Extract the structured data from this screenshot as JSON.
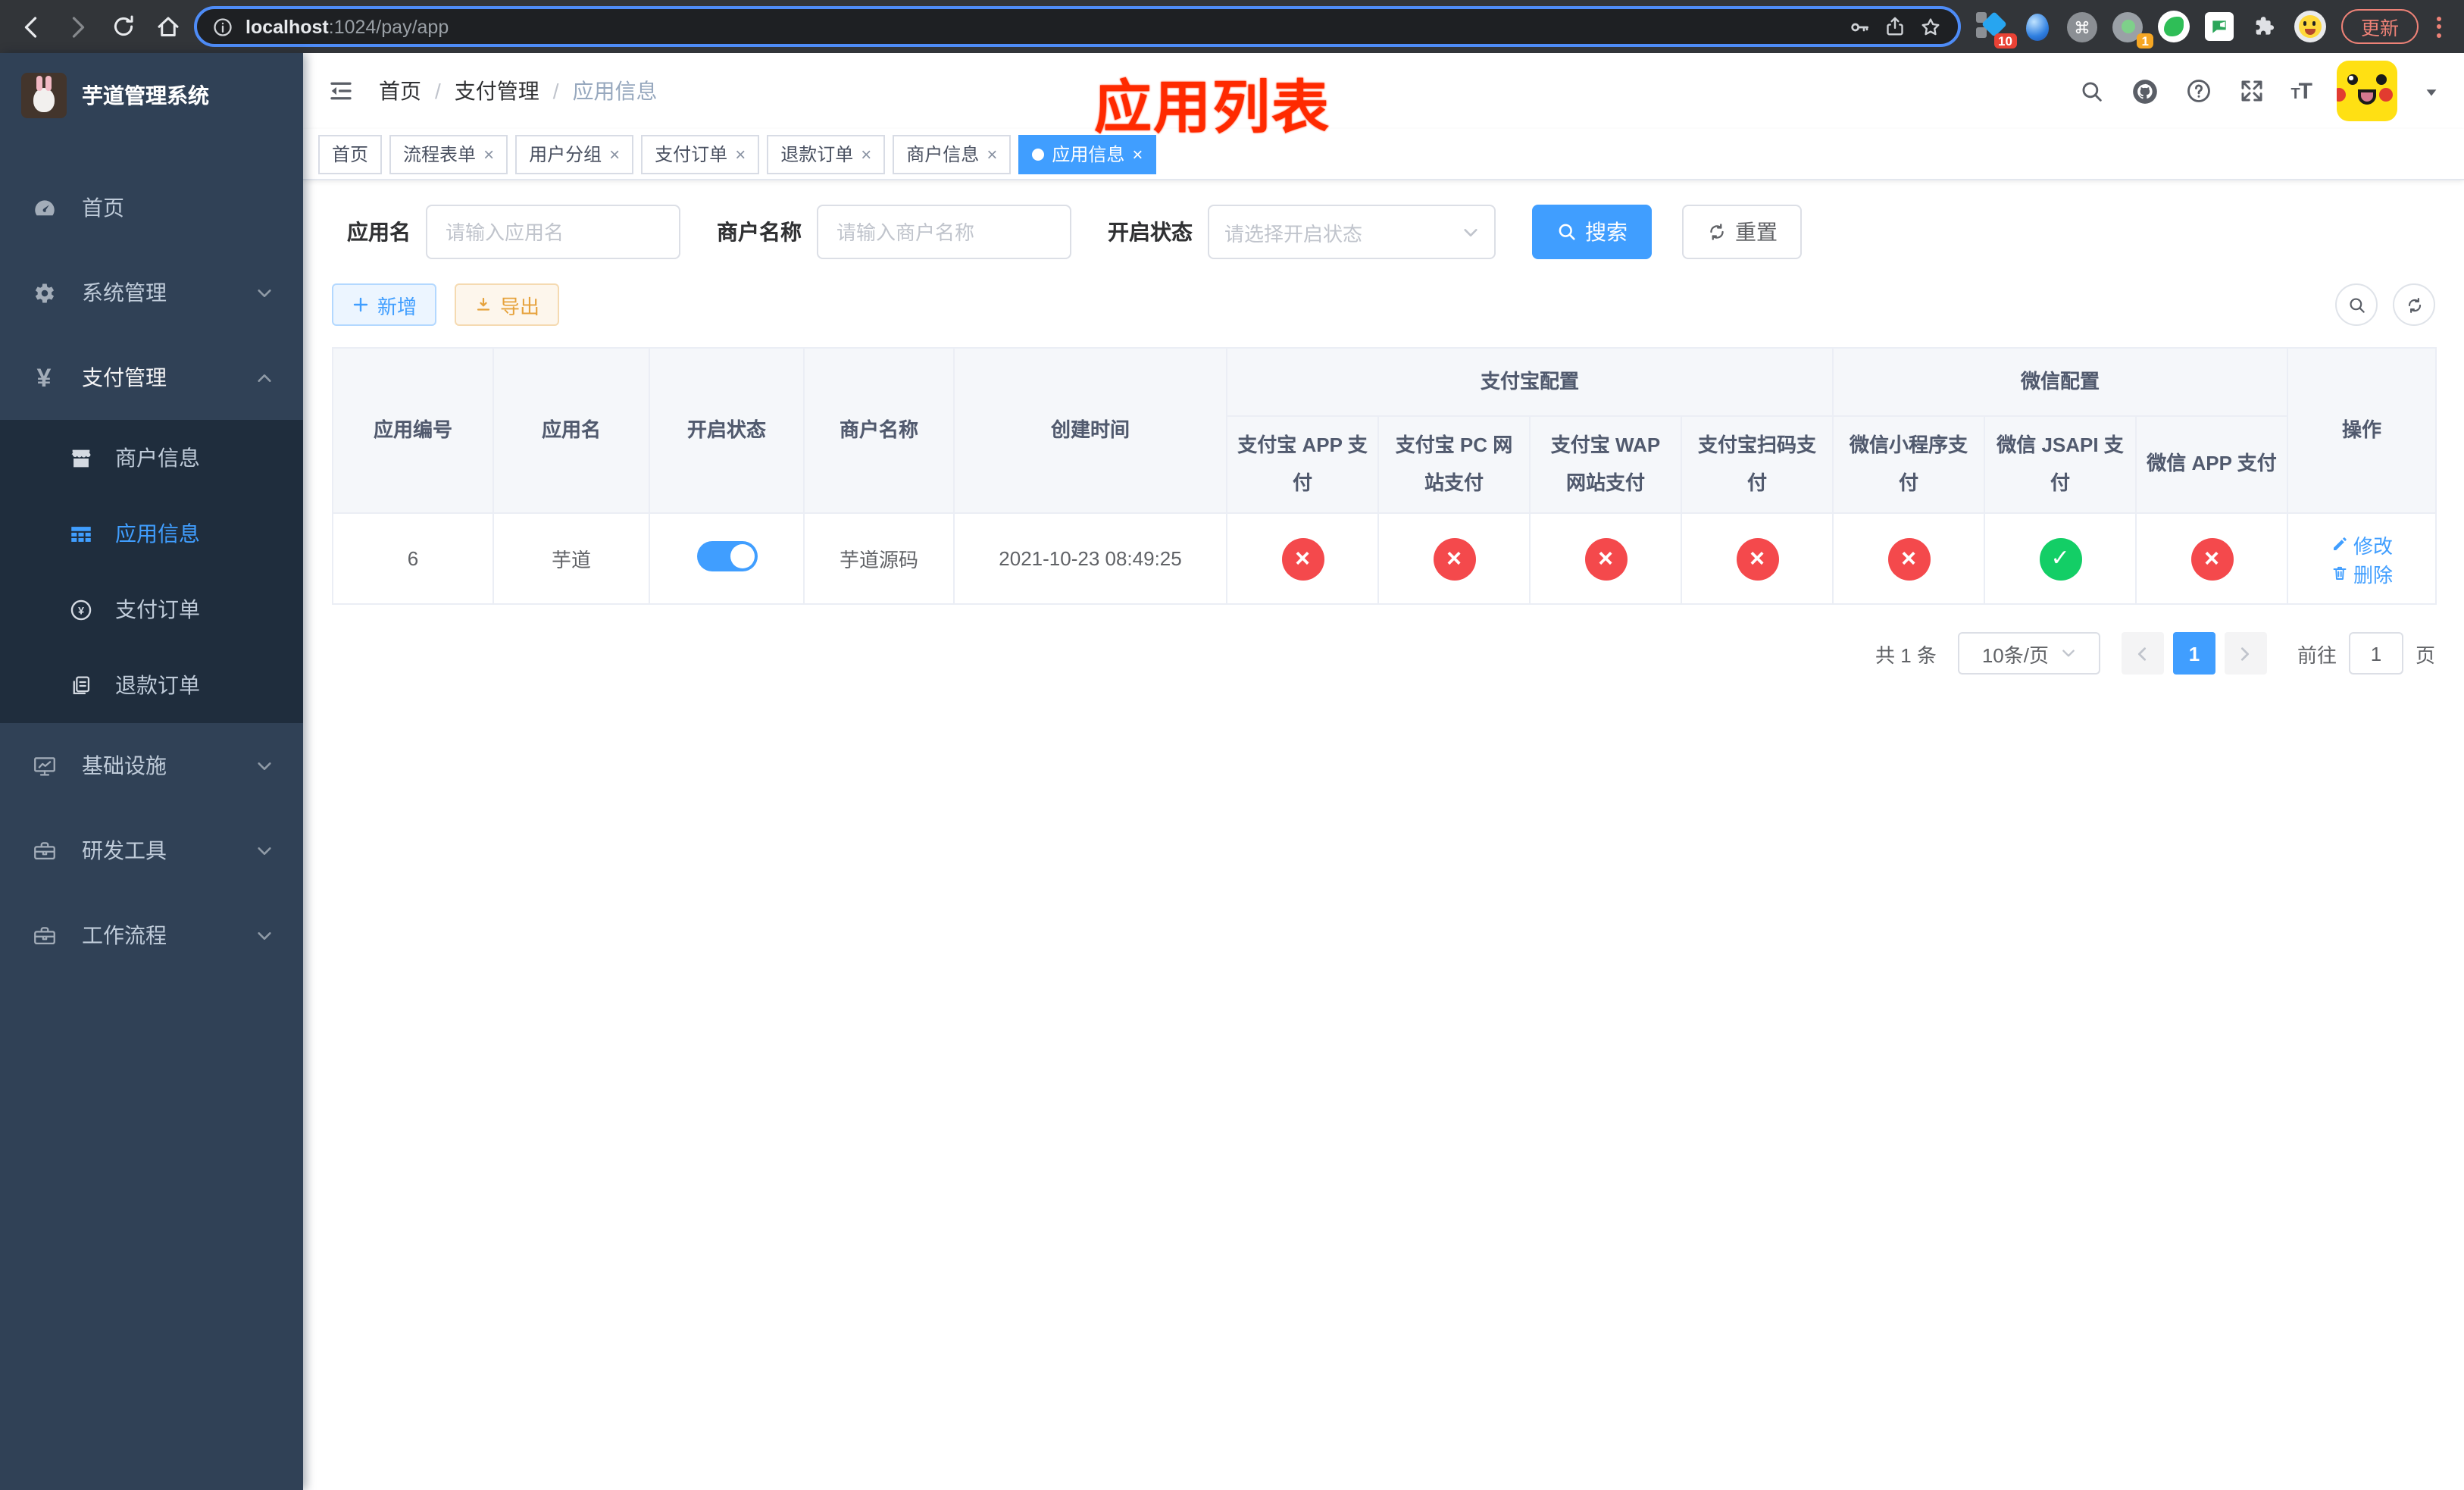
{
  "browser": {
    "url_host": "localhost",
    "url_rest": ":1024/pay/app",
    "update_label": "更新",
    "badges": {
      "first_ext": "10",
      "recorder_ext": "1"
    }
  },
  "sidebar": {
    "title": "芋道管理系统",
    "menu": [
      {
        "label": "首页"
      },
      {
        "label": "系统管理"
      },
      {
        "label": "支付管理"
      },
      {
        "label": "基础设施"
      },
      {
        "label": "研发工具"
      },
      {
        "label": "工作流程"
      }
    ],
    "submenu": [
      {
        "label": "商户信息"
      },
      {
        "label": "应用信息"
      },
      {
        "label": "支付订单"
      },
      {
        "label": "退款订单"
      }
    ]
  },
  "navbar": {
    "breadcrumb": [
      "首页",
      "支付管理",
      "应用信息"
    ],
    "annotation": "应用列表"
  },
  "tabs": [
    {
      "label": "首页"
    },
    {
      "label": "流程表单"
    },
    {
      "label": "用户分组"
    },
    {
      "label": "支付订单"
    },
    {
      "label": "退款订单"
    },
    {
      "label": "商户信息"
    },
    {
      "label": "应用信息"
    }
  ],
  "filters": {
    "app_name_label": "应用名",
    "app_name_placeholder": "请输入应用名",
    "merchant_label": "商户名称",
    "merchant_placeholder": "请输入商户名称",
    "status_label": "开启状态",
    "status_placeholder": "请选择开启状态",
    "search_label": "搜索",
    "reset_label": "重置"
  },
  "toolbar": {
    "add_label": "新增",
    "export_label": "导出"
  },
  "table": {
    "columns": {
      "id": "应用编号",
      "name": "应用名",
      "status": "开启状态",
      "merchant": "商户名称",
      "created": "创建时间",
      "actions": "操作"
    },
    "groups": {
      "alipay": "支付宝配置",
      "wechat": "微信配置"
    },
    "subcolumns": [
      "支付宝 APP 支付",
      "支付宝 PC 网站支付",
      "支付宝 WAP 网站支付",
      "支付宝扫码支付",
      "微信小程序支付",
      "微信 JSAPI 支付",
      "微信 APP 支付"
    ],
    "row": {
      "id": "6",
      "name": "芋道",
      "status": "on",
      "merchant": "芋道源码",
      "created": "2021-10-23 08:49:25",
      "channels": [
        "closed",
        "closed",
        "closed",
        "closed",
        "closed",
        "open",
        "closed"
      ],
      "edit_label": "修改",
      "delete_label": "删除"
    }
  },
  "pagination": {
    "total": "共 1 条",
    "page_size": "10条/页",
    "page": "1",
    "goto_label": "前往",
    "goto_value": "1",
    "goto_suffix": "页"
  },
  "colors": {
    "accent": "#409eff",
    "annotation_red": "#ff2a00",
    "status_open": "#13ce66",
    "status_closed": "#f4494c",
    "warning": "#e6a23c",
    "sidebar_bg": "#304156",
    "submenu_bg": "#1f2d3d",
    "urlbar_focus": "#4e8cf7",
    "update_red": "#ee8277"
  }
}
